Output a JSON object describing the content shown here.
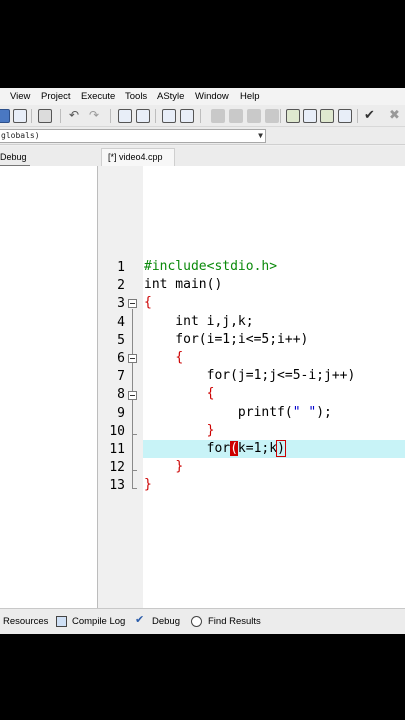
{
  "menu": [
    "View",
    "Project",
    "Execute",
    "Tools",
    "AStyle",
    "Window",
    "Help"
  ],
  "combo": {
    "value": "globals)"
  },
  "tabs": {
    "left": "Debug",
    "editor": "[*] video4.cpp"
  },
  "editor": {
    "line_numbers": [
      "1",
      "2",
      "3",
      "4",
      "5",
      "6",
      "7",
      "8",
      "9",
      "10",
      "11",
      "12",
      "13"
    ],
    "lines": [
      "#include<stdio.h>",
      "int main()",
      "{",
      "    int i,j,k;",
      "    for(i=1;i<=5;i++)",
      "    {",
      "        for(j=1;j<=5-i;j++)",
      "        {",
      "            printf(\" \");",
      "        }",
      "        for(k=1;k)",
      "    }",
      "}"
    ],
    "current_line": 11
  },
  "bottom_tabs": [
    "Resources",
    "Compile Log",
    "Debug",
    "Find Results"
  ],
  "colors": {
    "highlight": "#c8f3f7",
    "brace": "#cc0000",
    "preprocessor": "#0a8a0a"
  }
}
